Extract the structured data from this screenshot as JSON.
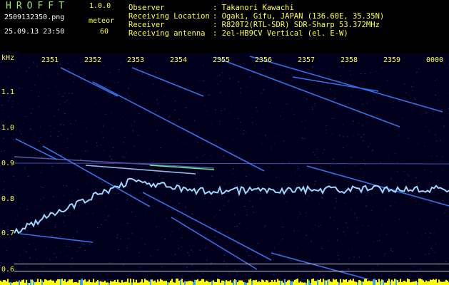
{
  "app": {
    "title": "HROFFT",
    "version": "1.0.0"
  },
  "file": {
    "name": "2509132350.png",
    "datetime": "25.09.13 23:50"
  },
  "meteor": {
    "label": "meteor",
    "count": "60"
  },
  "info": [
    {
      "key": "Observer",
      "value": ": Takanori Kawachi"
    },
    {
      "key": "Receiving Location",
      "value": ": Ogaki, Gifu, JAPAN (136.60E, 35.35N)"
    },
    {
      "key": "Receiver",
      "value": ": R820T2(RTL-SDR) SDR-Sharp 53.372MHz"
    },
    {
      "key": "Receiving antenna",
      "value": ": 2el-HB9CV Vertical (el. E-W)"
    }
  ],
  "axis": {
    "y_unit": "kHz",
    "x_ticks": [
      "2351",
      "2352",
      "2353",
      "2354",
      "2355",
      "2356",
      "2357",
      "2358",
      "2359",
      "0000"
    ],
    "y_ticks": [
      "1.1",
      "1.0",
      "0.9",
      "0.8",
      "0.7",
      "0.6"
    ]
  },
  "colors": {
    "label": "#ffff40",
    "title": "#9fe86a",
    "trace": "#3a7dff",
    "activity": "#ffff00"
  }
}
